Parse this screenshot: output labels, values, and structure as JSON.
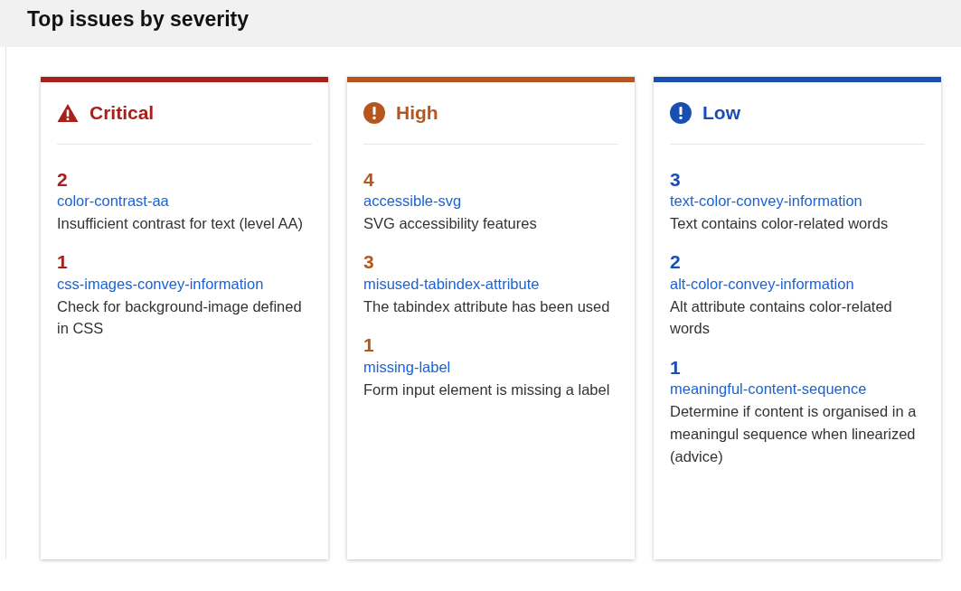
{
  "title": "Top issues by severity",
  "groups": [
    {
      "label": "Critical",
      "kind": "warning",
      "color": "#a8201a",
      "issues": [
        {
          "count": "2",
          "rule": "color-contrast-aa",
          "description": "Insufficient contrast for text (level AA)"
        },
        {
          "count": "1",
          "rule": "css-images-convey-information",
          "description": "Check for background-image defined in CSS"
        }
      ]
    },
    {
      "label": "High",
      "kind": "alert",
      "color": "#b5561e",
      "issues": [
        {
          "count": "4",
          "rule": "accessible-svg",
          "description": "SVG accessibility features"
        },
        {
          "count": "3",
          "rule": "misused-tabindex-attribute",
          "description": "The tabindex attribute has been used"
        },
        {
          "count": "1",
          "rule": "missing-label",
          "description": "Form input element is missing a label"
        }
      ]
    },
    {
      "label": "Low",
      "kind": "alert",
      "color": "#1a4fb2",
      "issues": [
        {
          "count": "3",
          "rule": "text-color-convey-information",
          "description": "Text contains color-related words"
        },
        {
          "count": "2",
          "rule": "alt-color-convey-information",
          "description": "Alt attribute contains color-related words"
        },
        {
          "count": "1",
          "rule": "meaningful-content-sequence",
          "description": "Determine if content is organised in a meaningul sequence when linearized (advice)"
        }
      ]
    }
  ]
}
